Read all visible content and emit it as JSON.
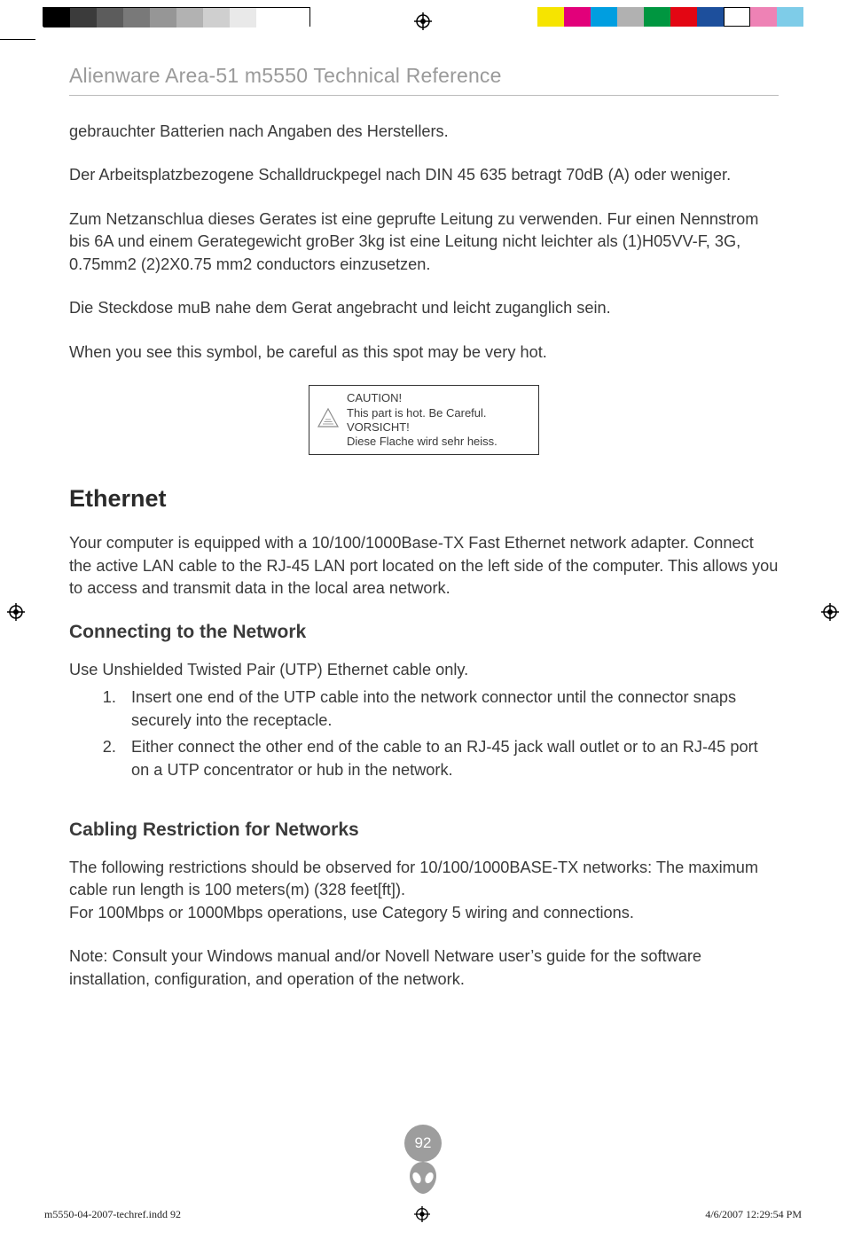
{
  "header": {
    "title": "Alienware Area-51 m5550 Technical Reference"
  },
  "body": {
    "p1": "gebrauchter Batterien nach Angaben des Herstellers.",
    "p2": "Der Arbeitsplatzbezogene Schalldruckpegel nach DIN 45 635 betragt 70dB (A) oder weniger.",
    "p3": "Zum Netzanschlua dieses Gerates ist eine geprufte Leitung zu verwenden. Fur einen Nennstrom bis 6A und einem Gerategewicht groBer 3kg ist eine Leitung nicht leichter als (1)H05VV-F, 3G, 0.75mm2 (2)2X0.75 mm2 conductors einzusetzen.",
    "p4": "Die Steckdose muB nahe dem Gerat angebracht und leicht zuganglich sein.",
    "p5": "When you see this symbol, be careful as this spot may be very hot.",
    "caution": {
      "l1": "CAUTION!",
      "l2": "This part is hot. Be Careful.",
      "l3": "VORSICHT!",
      "l4": "Diese Flache wird sehr heiss."
    },
    "h_ethernet": "Ethernet",
    "p_ethernet": "Your computer is equipped with a 10/100/1000Base-TX Fast Ethernet network adapter. Connect the active LAN cable to the RJ-45 LAN port located on the left side of the computer. This allows you to access and transmit data in the local area network.",
    "h_connect": "Connecting to the Network",
    "p_connect_intro": "Use Unshielded Twisted Pair (UTP) Ethernet cable only.",
    "steps": [
      "Insert one end of the UTP cable into the network connector until the connector snaps securely into the receptacle.",
      "Either connect the other end of the cable to an RJ-45 jack wall outlet or to an RJ-45 port on a UTP concentrator or hub in the network."
    ],
    "h_cabling": "Cabling Restriction for Networks",
    "p_cabling_1": "The following restrictions should be observed for 10/100/1000BASE-TX networks: The maximum cable run length is 100 meters(m) (328 feet[ft]).",
    "p_cabling_2": "For 100Mbps or 1000Mbps operations, use Category 5 wiring and connections.",
    "p_note": "Note: Consult your Windows manual and/or Novell Netware user’s guide for the software installation, configuration, and operation of the network."
  },
  "page_number": "92",
  "footer": {
    "left": "m5550-04-2007-techref.indd   92",
    "right": "4/6/2007   12:29:54 PM"
  },
  "calibration": {
    "grays": [
      "#000000",
      "#3b3b3b",
      "#5c5c5c",
      "#797979",
      "#969696",
      "#b2b2b2",
      "#cfcfcf",
      "#e9e9e9",
      "#ffffff",
      "#ffffff"
    ],
    "colors_right": [
      "#f6e400",
      "#e2007a",
      "#009ee0",
      "#b1b1b1",
      "#009640",
      "#e30613",
      "#1d4f9c",
      "#ffffff",
      "#ee82b5",
      "#7ecce8"
    ]
  }
}
